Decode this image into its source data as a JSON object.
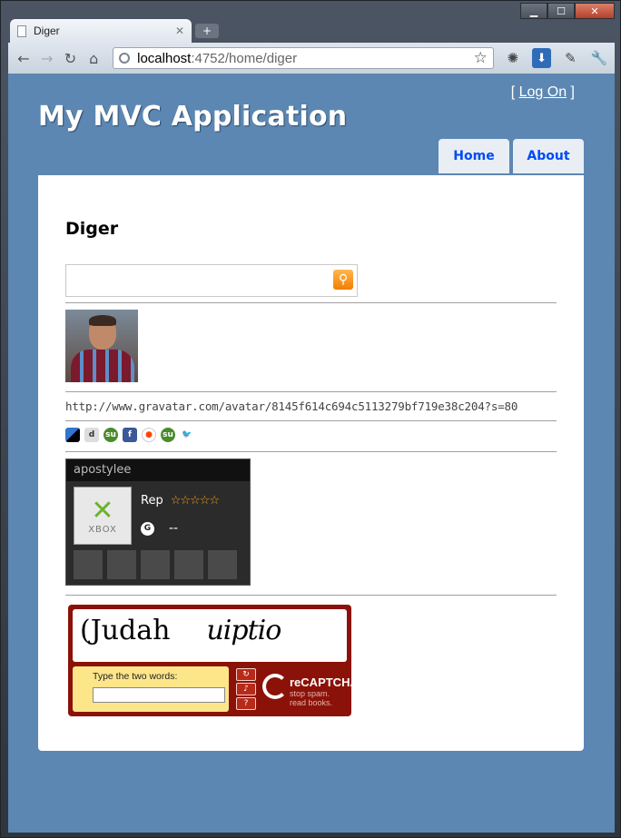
{
  "browser": {
    "tab_title": "Diger",
    "url_host": "localhost",
    "url_rest": ":4752/home/diger",
    "window_controls": {
      "minimize": "▁",
      "maximize": "☐",
      "close": "✕"
    },
    "nav_icons": {
      "back": "←",
      "forward": "→",
      "reload": "↻",
      "home": "⌂"
    }
  },
  "site": {
    "login_prefix": "[",
    "login_link": "Log On",
    "login_suffix": "]",
    "title": "My MVC Application",
    "menu": [
      {
        "label": "Home"
      },
      {
        "label": "About"
      }
    ]
  },
  "page": {
    "heading": "Diger",
    "search_value": "",
    "gravatar_url": "http://www.gravatar.com/avatar/8145f614c694c5113279bf719e38c204?s=80",
    "share_icons": [
      "delicious-icon",
      "digg-icon",
      "stumbleupon-icon",
      "facebook-icon",
      "reddit-icon",
      "stumbleupon-icon",
      "twitter-icon"
    ]
  },
  "xbox_card": {
    "gamertag": "apostylee",
    "logo_text": "XBOX",
    "rep_label": "Rep",
    "stars": "☆☆☆☆☆",
    "gamerscore_icon": "G",
    "gamerscore": "--"
  },
  "captcha": {
    "word1": "(Judah",
    "word2": "uiptio",
    "prompt": "Type the two words:",
    "brand": "reCAPTCHA™",
    "tagline1": "stop spam.",
    "tagline2": "read books."
  }
}
